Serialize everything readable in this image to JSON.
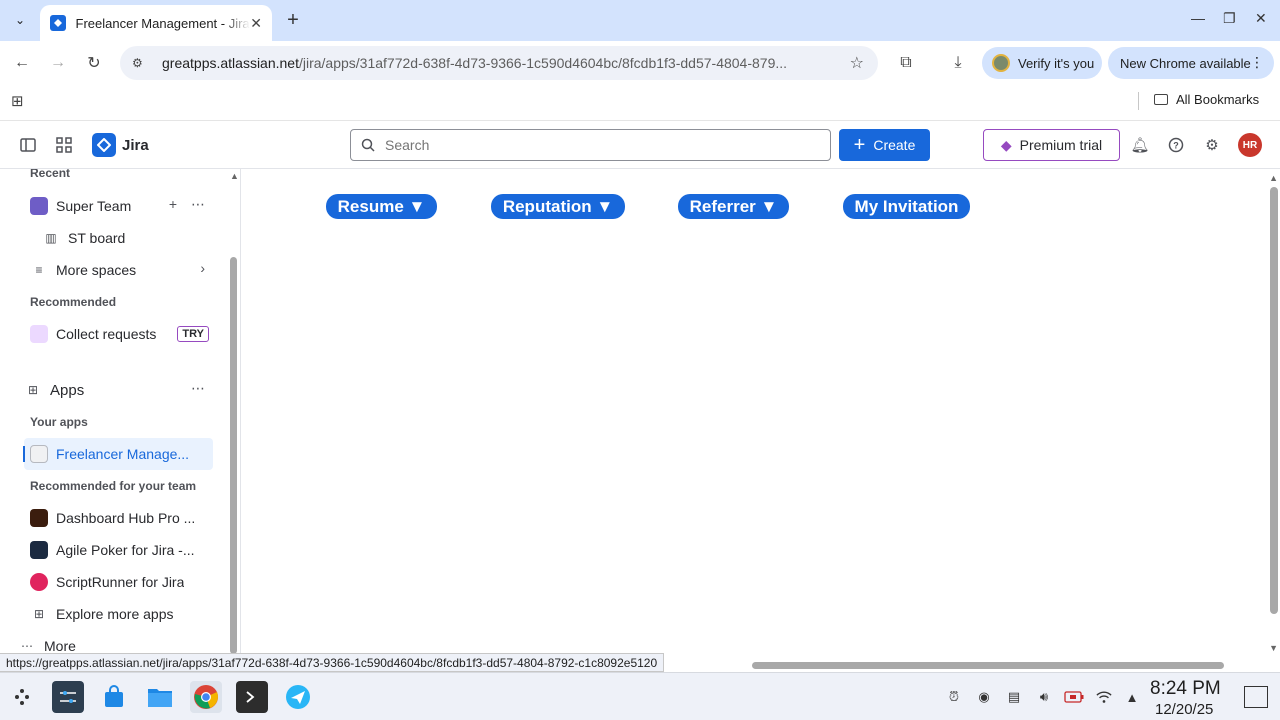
{
  "browser": {
    "tab_title": "Freelancer Management - Jira",
    "url_host": "greatpps.atlassian.net",
    "url_path": "/jira/apps/31af772d-638f-4d73-9366-1c590d4604bc/8fcdb1f3-dd57-4804-879...",
    "verify_label": "Verify it's you",
    "update_label": "New Chrome available",
    "all_bookmarks": "All Bookmarks",
    "status_url": "https://greatpps.atlassian.net/jira/apps/31af772d-638f-4d73-9366-1c590d4604bc/8fcdb1f3-dd57-4804-8792-c1c8092e5120"
  },
  "jira": {
    "product": "Jira",
    "search_placeholder": "Search",
    "create_label": "Create",
    "premium_label": "Premium trial",
    "avatar_initials": "HR"
  },
  "sidebar": {
    "recent": "Recent",
    "super_team": "Super Team",
    "st_board": "ST board",
    "more_spaces": "More spaces",
    "recommended": "Recommended",
    "collect_requests": "Collect requests",
    "try_badge": "TRY",
    "apps": "Apps",
    "your_apps": "Your apps",
    "freelancer_app": "Freelancer Manage...",
    "recommended_team": "Recommended for your team",
    "dashboard_hub": "Dashboard Hub Pro ...",
    "agile_poker": "Agile Poker for Jira -...",
    "scriptrunner": "ScriptRunner for Jira",
    "explore_apps": "Explore more apps",
    "more": "More"
  },
  "main": {
    "buttons": [
      "Resume ▼",
      "Reputation ▼",
      "Referrer ▼",
      "My Invitation"
    ]
  },
  "taskbar": {
    "time": "8:24 PM",
    "date": "12/20/25"
  },
  "colors": {
    "jira_blue": "#1868db",
    "tab_strip": "#d3e3fd",
    "premium_purple": "#964ac0",
    "avatar_red": "#c9372c"
  }
}
